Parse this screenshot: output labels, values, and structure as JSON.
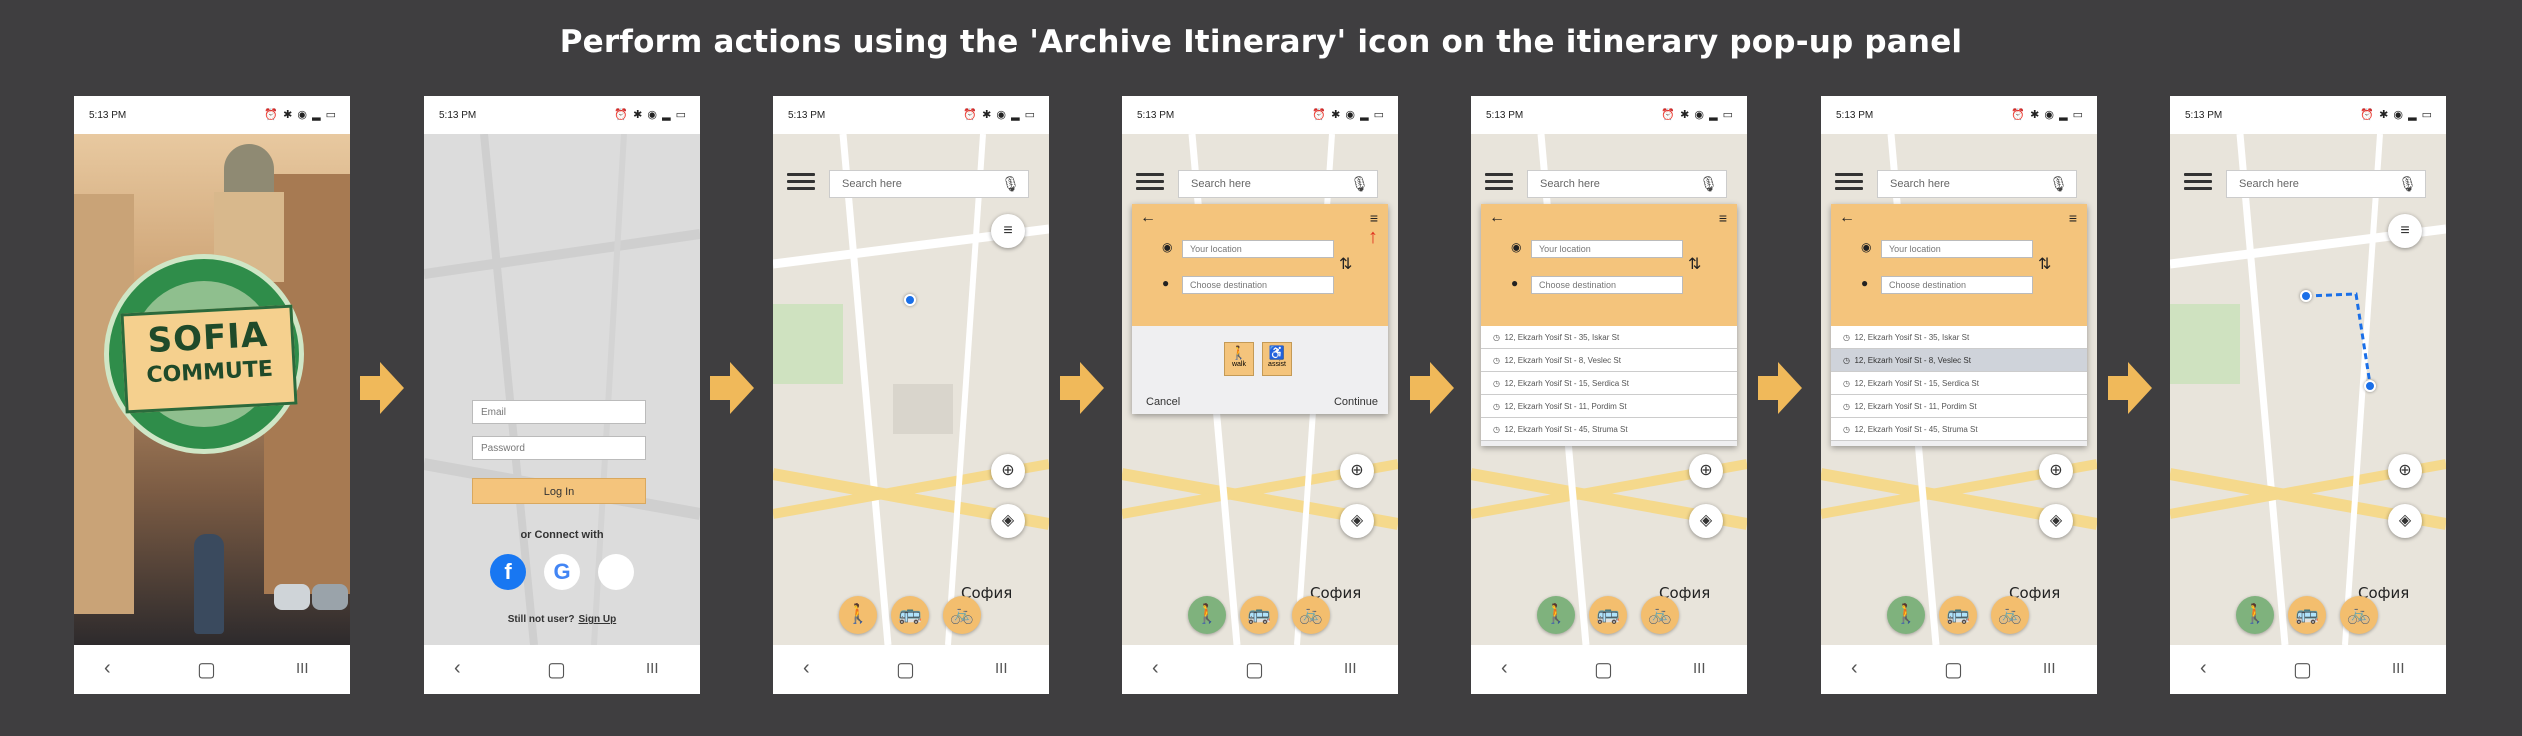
{
  "headline": "Perform actions using the 'Archive Itinerary' icon on the itinerary pop-up panel",
  "status": {
    "time": "5:13 PM",
    "icons": "⏰ ✱ ◉ ▂ ▭"
  },
  "nav": {
    "back": "‹",
    "home": "▢",
    "recent": "III"
  },
  "splash": {
    "line1": "SOFIA",
    "line2": "COMMUTE"
  },
  "login": {
    "email_placeholder": "Email",
    "password_placeholder": "Password",
    "login_label": "Log In",
    "or_connect": "or Connect with",
    "not_user": "Still not user?",
    "sign_up": "Sign Up",
    "social": [
      "f",
      "G",
      ""
    ]
  },
  "map": {
    "search_placeholder": "Search here",
    "city_label": "София",
    "mic_icon": "🎙",
    "filter_icon": "≡",
    "locate_icon": "⊕",
    "layers_icon": "◈"
  },
  "modes": {
    "walk": "🚶",
    "bus": "🚌",
    "bike": "🚲"
  },
  "panel": {
    "back_icon": "←",
    "list_icon": "≡",
    "archive_icon": "↑",
    "your_location": "Your location",
    "choose_destination": "Choose destination",
    "walk_label": "walk",
    "assist_label": "assist",
    "walk_icon": "🚶",
    "assist_icon": "♿",
    "cancel": "Cancel",
    "continue": "Continue",
    "swap_icon": "⇅",
    "origin_icon": "◉",
    "dest_icon": "●"
  },
  "history": [
    "12, Ekzarh Yosif St - 35, Iskar St",
    "12, Ekzarh Yosif St - 8, Veslec St",
    "12, Ekzarh Yosif St - 15, Serdica St",
    "12, Ekzarh Yosif St - 11, Pordim St",
    "12, Ekzarh Yosif St - 45, Struma St"
  ],
  "colors": {
    "accent": "#f4c47c",
    "arrow": "#f0b95a",
    "active_mode": "#7fb27d",
    "archive_red": "#e0301e",
    "background": "#3f3e40"
  }
}
